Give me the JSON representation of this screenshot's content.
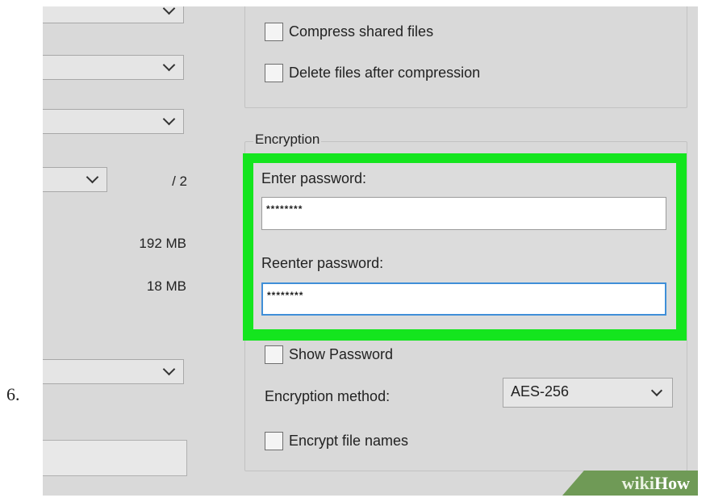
{
  "step_number": "6.",
  "left_column": {
    "volume_count_suffix": "/ 2",
    "size_1": "192 MB",
    "size_2": "18 MB"
  },
  "compression_options": {
    "compress_shared_files": {
      "label": "Compress shared files",
      "checked": false
    },
    "delete_after_compression": {
      "label": "Delete files after compression",
      "checked": false
    }
  },
  "encryption": {
    "group_title": "Encryption",
    "enter_password_label": "Enter password:",
    "enter_password_value": "********",
    "reenter_password_label": "Reenter password:",
    "reenter_password_value": "********",
    "show_password": {
      "label": "Show Password",
      "checked": false
    },
    "method_label": "Encryption method:",
    "method_value": "AES-256",
    "encrypt_file_names": {
      "label": "Encrypt file names",
      "checked": false
    }
  },
  "highlight_color": "#14e51e",
  "watermark": {
    "part1": "wiki",
    "part2": "How"
  }
}
